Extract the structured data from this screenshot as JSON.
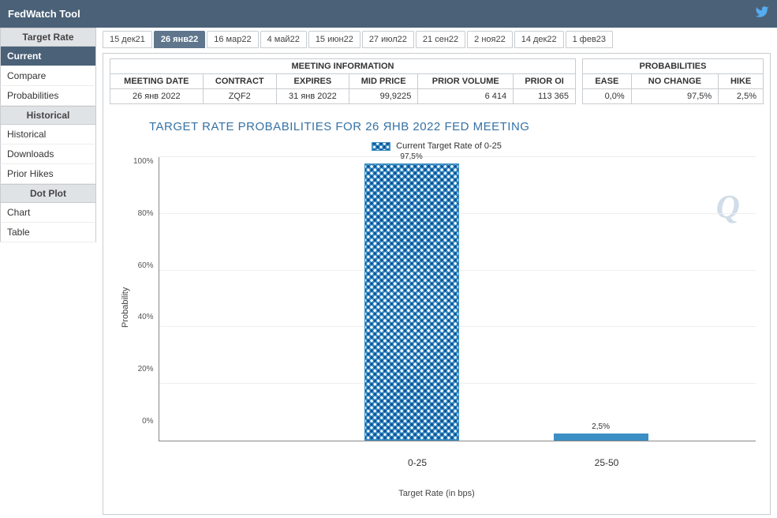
{
  "header": {
    "title": "FedWatch Tool"
  },
  "sidebar": {
    "sections": [
      {
        "title": "Target Rate",
        "items": [
          {
            "label": "Current",
            "active": true
          },
          {
            "label": "Compare"
          },
          {
            "label": "Probabilities"
          }
        ]
      },
      {
        "title": "Historical",
        "items": [
          {
            "label": "Historical"
          },
          {
            "label": "Downloads"
          },
          {
            "label": "Prior Hikes"
          }
        ]
      },
      {
        "title": "Dot Plot",
        "items": [
          {
            "label": "Chart"
          },
          {
            "label": "Table"
          }
        ]
      }
    ]
  },
  "tabs": [
    {
      "label": "15 дек21"
    },
    {
      "label": "26 янв22",
      "active": true
    },
    {
      "label": "16 мар22"
    },
    {
      "label": "4 май22"
    },
    {
      "label": "15 июн22"
    },
    {
      "label": "27 июл22"
    },
    {
      "label": "21 сен22"
    },
    {
      "label": "2 ноя22"
    },
    {
      "label": "14 дек22"
    },
    {
      "label": "1 фев23"
    }
  ],
  "meeting_info": {
    "section": "MEETING INFORMATION",
    "headers": [
      "MEETING DATE",
      "CONTRACT",
      "EXPIRES",
      "MID PRICE",
      "PRIOR VOLUME",
      "PRIOR OI"
    ],
    "row": [
      "26 янв 2022",
      "ZQF2",
      "31 янв 2022",
      "99,9225",
      "6 414",
      "113 365"
    ]
  },
  "probabilities_info": {
    "section": "PROBABILITIES",
    "headers": [
      "EASE",
      "NO CHANGE",
      "HIKE"
    ],
    "row": [
      "0,0%",
      "97,5%",
      "2,5%"
    ]
  },
  "chart_data": {
    "type": "bar",
    "title": "TARGET RATE PROBABILITIES FOR 26 ЯНВ 2022 FED MEETING",
    "legend": "Current Target Rate of 0-25",
    "xlabel": "Target Rate (in bps)",
    "ylabel": "Probability",
    "ylim": [
      0,
      100
    ],
    "yticks": [
      "0%",
      "20%",
      "40%",
      "60%",
      "80%",
      "100%"
    ],
    "categories": [
      "0-25",
      "25-50"
    ],
    "values": [
      97.5,
      2.5
    ],
    "value_labels": [
      "97,5%",
      "2,5%"
    ],
    "styles": [
      "hatched",
      "solid"
    ]
  },
  "watermark": "Q"
}
